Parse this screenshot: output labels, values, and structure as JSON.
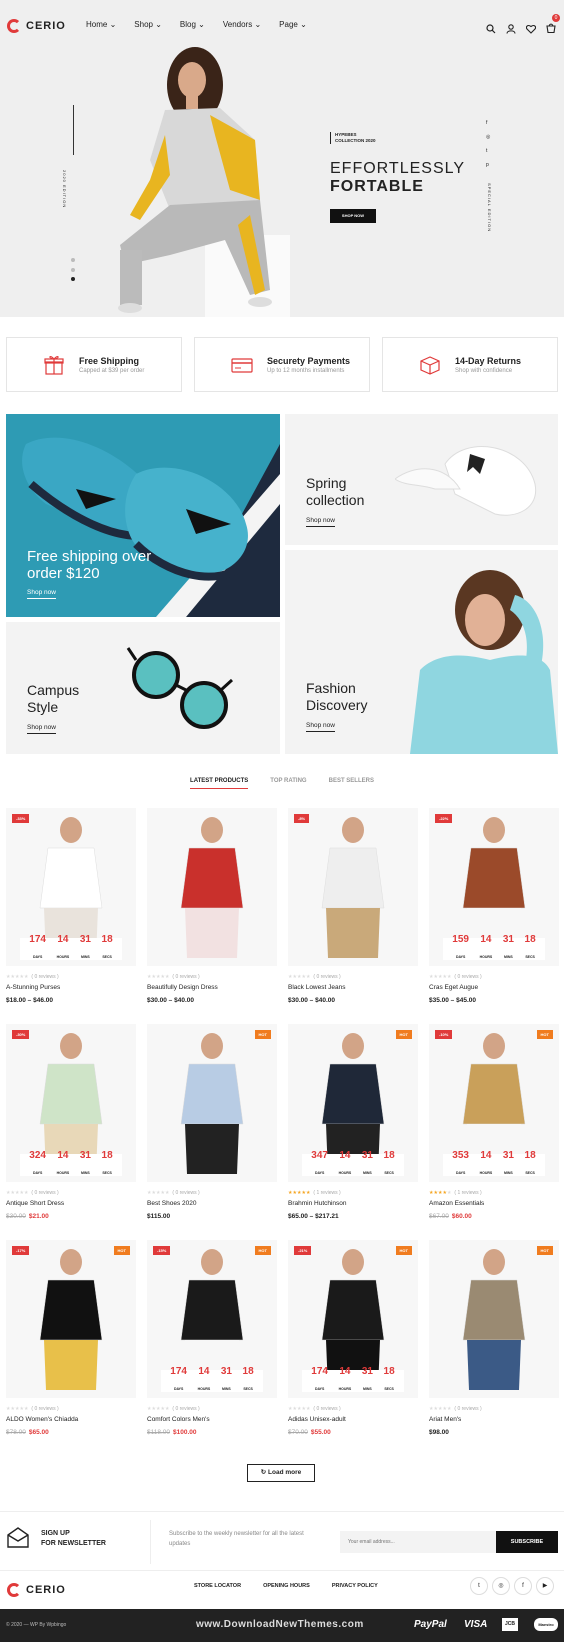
{
  "brand": {
    "name": "CERIO",
    "accent": "#e03a3a"
  },
  "nav": {
    "items": [
      "Home",
      "Shop",
      "Blog",
      "Vendors",
      "Page"
    ]
  },
  "header_icons": [
    "search-icon",
    "user-icon",
    "heart-icon",
    "cart-icon"
  ],
  "cart_count": "0",
  "hero": {
    "side_label": "2020 EDITION",
    "tag_line1": "HYPEBES",
    "tag_line2": "COLLECTION 2020",
    "title_line1": "EFFORTLESSLY",
    "title_line2": "FORTABLE",
    "button": "SHOP NOW",
    "right_label": "SPECIAL EDITION"
  },
  "features": [
    {
      "title": "Free Shipping",
      "subtitle": "Capped at $39 per order",
      "icon": "gift-icon"
    },
    {
      "title": "Securety Payments",
      "subtitle": "Up to 12 months installments",
      "icon": "card-icon"
    },
    {
      "title": "14-Day Returns",
      "subtitle": "Shop with confidence",
      "icon": "box-icon"
    }
  ],
  "banners": [
    {
      "title_line1": "Free shipping over",
      "title_line2": "order $120",
      "link": "Shop now"
    },
    {
      "title_line1": "Spring",
      "title_line2": "collection",
      "link": "Shop now"
    },
    {
      "title_line1": "Campus",
      "title_line2": "Style",
      "link": "Shop now"
    },
    {
      "title_line1": "Fashion",
      "title_line2": "Discovery",
      "link": "Shop now"
    }
  ],
  "tabs": [
    "LATEST PRODUCTS",
    "TOP RATING",
    "BEST SELLERS"
  ],
  "countdown_labels": [
    "DAYS",
    "HOURS",
    "MINS",
    "SECS"
  ],
  "products": [
    {
      "name": "A-Stunning Purses",
      "price": "$18.00 – $46.00",
      "old": "",
      "reviews": "( 0 reviews )",
      "badge": "-33%",
      "badge_color": "#e03a3a",
      "badge2": "",
      "countdown": [
        "174",
        "14",
        "31",
        "18"
      ],
      "rating": 0
    },
    {
      "name": "Beautifully Design Dress",
      "price": "$30.00 – $40.00",
      "old": "",
      "reviews": "( 0 reviews )",
      "badge": "",
      "badge_color": "",
      "badge2": "",
      "countdown": null,
      "rating": 0
    },
    {
      "name": "Black Lowest Jeans",
      "price": "$30.00 – $40.00",
      "old": "",
      "reviews": "( 0 reviews )",
      "badge": "-8%",
      "badge_color": "#e03a3a",
      "badge2": "",
      "countdown": null,
      "rating": 0
    },
    {
      "name": "Cras Eget Augue",
      "price": "$35.00 – $45.00",
      "old": "",
      "reviews": "( 0 reviews )",
      "badge": "-22%",
      "badge_color": "#e03a3a",
      "badge2": "",
      "countdown": [
        "159",
        "14",
        "31",
        "18"
      ],
      "rating": 0
    },
    {
      "name": "Antique Short Dress",
      "price": "$21.00",
      "old": "$30.00",
      "reviews": "( 0 reviews )",
      "badge": "-30%",
      "badge_color": "#e03a3a",
      "badge2": "",
      "countdown": [
        "324",
        "14",
        "31",
        "18"
      ],
      "rating": 0
    },
    {
      "name": "Best Shoes 2020",
      "price": "$115.00",
      "old": "",
      "reviews": "( 0 reviews )",
      "badge": "",
      "badge_color": "",
      "badge2": "HOT",
      "countdown": null,
      "rating": 0
    },
    {
      "name": "Brahmin Hutchinson",
      "price": "$65.00 – $217.21",
      "old": "",
      "reviews": "( 1 reviews )",
      "badge": "",
      "badge_color": "",
      "badge2": "HOT",
      "countdown": [
        "347",
        "14",
        "31",
        "18"
      ],
      "rating": 5
    },
    {
      "name": "Amazon Essentials",
      "price": "$60.00",
      "old": "$67.00",
      "reviews": "( 1 reviews )",
      "badge": "-10%",
      "badge_color": "#e03a3a",
      "badge2": "HOT",
      "countdown": [
        "353",
        "14",
        "31",
        "18"
      ],
      "rating": 4
    },
    {
      "name": "ALDO Women's Chiadda",
      "price": "$65.00",
      "old": "$78.00",
      "reviews": "( 0 reviews )",
      "badge": "-17%",
      "badge_color": "#e03a3a",
      "badge2": "HOT",
      "countdown": null,
      "rating": 0
    },
    {
      "name": "Comfort Colors Men's",
      "price": "$100.00",
      "old": "$118.00",
      "reviews": "( 0 reviews )",
      "badge": "-15%",
      "badge_color": "#e03a3a",
      "badge2": "HOT",
      "countdown": [
        "174",
        "14",
        "31",
        "18"
      ],
      "rating": 0
    },
    {
      "name": "Adidas Unisex-adult",
      "price": "$55.00",
      "old": "$70.00",
      "reviews": "( 0 reviews )",
      "badge": "-21%",
      "badge_color": "#e03a3a",
      "badge2": "HOT",
      "countdown": [
        "174",
        "14",
        "31",
        "18"
      ],
      "rating": 0
    },
    {
      "name": "Ariat Men's",
      "price": "$98.00",
      "old": "",
      "reviews": "( 0 reviews )",
      "badge": "",
      "badge_color": "",
      "badge2": "HOT",
      "countdown": null,
      "rating": 0
    }
  ],
  "load_more": "Load more",
  "newsletter": {
    "title_line1": "SIGN UP",
    "title_line2": "FOR NEWSLETTER",
    "text": "Subscribe to the weekly newsletter for all the latest updates",
    "placeholder": "Your email address...",
    "button": "SUBSCRIBE"
  },
  "footer": {
    "links": [
      "STORE LOCATOR",
      "OPENING HOURS",
      "PRIVACY POLICY"
    ],
    "social": [
      "twitter-icon",
      "instagram-icon",
      "facebook-icon",
      "youtube-icon"
    ],
    "copyright": "© 2020 — WP By Wpbingo",
    "watermark": "www.DownloadNewThemes.com",
    "payments": [
      "PayPal",
      "VISA",
      "JCB",
      "Maestro"
    ]
  }
}
